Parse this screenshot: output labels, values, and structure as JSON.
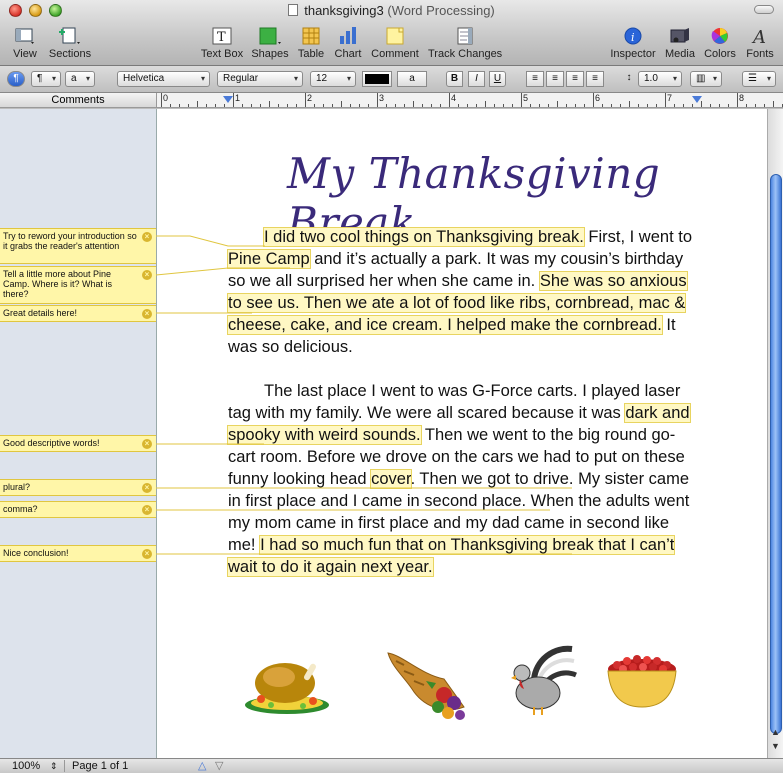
{
  "window": {
    "title": "thanksgiving3",
    "subtitle": "(Word Processing)"
  },
  "toolbar": {
    "view": "View",
    "sections": "Sections",
    "text_box": "Text Box",
    "shapes": "Shapes",
    "table": "Table",
    "chart": "Chart",
    "comment": "Comment",
    "track_changes": "Track Changes",
    "inspector": "Inspector",
    "media": "Media",
    "colors": "Colors",
    "fonts": "Fonts"
  },
  "format_bar": {
    "paragraph_style": "¶",
    "char_style": "a",
    "font_family": "Helvetica",
    "font_style": "Regular",
    "font_size": "12",
    "text_color": "#000000",
    "highlight_label": "a",
    "bold": "B",
    "italic": "I",
    "underline": "U",
    "line_spacing": "1.0"
  },
  "comments_header": "Comments",
  "ruler": {
    "numbers": [
      "0",
      "1",
      "2",
      "3",
      "4",
      "5",
      "6",
      "7",
      "8"
    ]
  },
  "comments": [
    {
      "text": "Try to reword your introduction so it grabs the reader's attention"
    },
    {
      "text": "Tell a little more about Pine Camp.  Where is it?  What is there?"
    },
    {
      "text": "Great details here!"
    },
    {
      "text": "Good descriptive words!"
    },
    {
      "text": "plural?"
    },
    {
      "text": "comma?"
    },
    {
      "text": "Nice conclusion!"
    }
  ],
  "document": {
    "title": "My Thanksgiving Break",
    "paragraph1": {
      "s1": "I did two cool things on Thanksgiving break.",
      "s2": " First, I went to ",
      "s3": "Pine Camp",
      "s4": " and it’s actually a park. It was my cousin’s birthday so we all surprised her when she came in. ",
      "s5": "She was so anxious to see us. Then we ate a lot of food like ribs, cornbread, mac & cheese, cake, and ice cream. I helped make the cornbread.",
      "s6": " It was so delicious."
    },
    "paragraph2": {
      "s1": "The last place I went to was G-Force carts. I played laser tag with my family. We were all scared because it was ",
      "s2": "dark and spooky with weird sounds.",
      "s3": " Then we went to the big round go-cart room. Before we drove on the cars we had to put on these funny looking head ",
      "s4": "cover",
      "s5": ". Then we got to drive. My sister came in first place",
      "s6": " and I came in second place. When the adults went my mom came in first place and my dad came in second like me! ",
      "s7": "I had so much fun that on Thanksgiving break that I can’t wait to do it again next year."
    },
    "images": [
      "turkey-dinner",
      "cornucopia",
      "turkey",
      "cranberry-bowl"
    ]
  },
  "status_bar": {
    "zoom": "100%",
    "page_info": "Page 1 of 1"
  },
  "colors": {
    "highlight": "#fff8c4",
    "comment_bg": "#fff6a8",
    "title_color": "#3a2a7a",
    "scroll_blue": "#4e86e0"
  }
}
